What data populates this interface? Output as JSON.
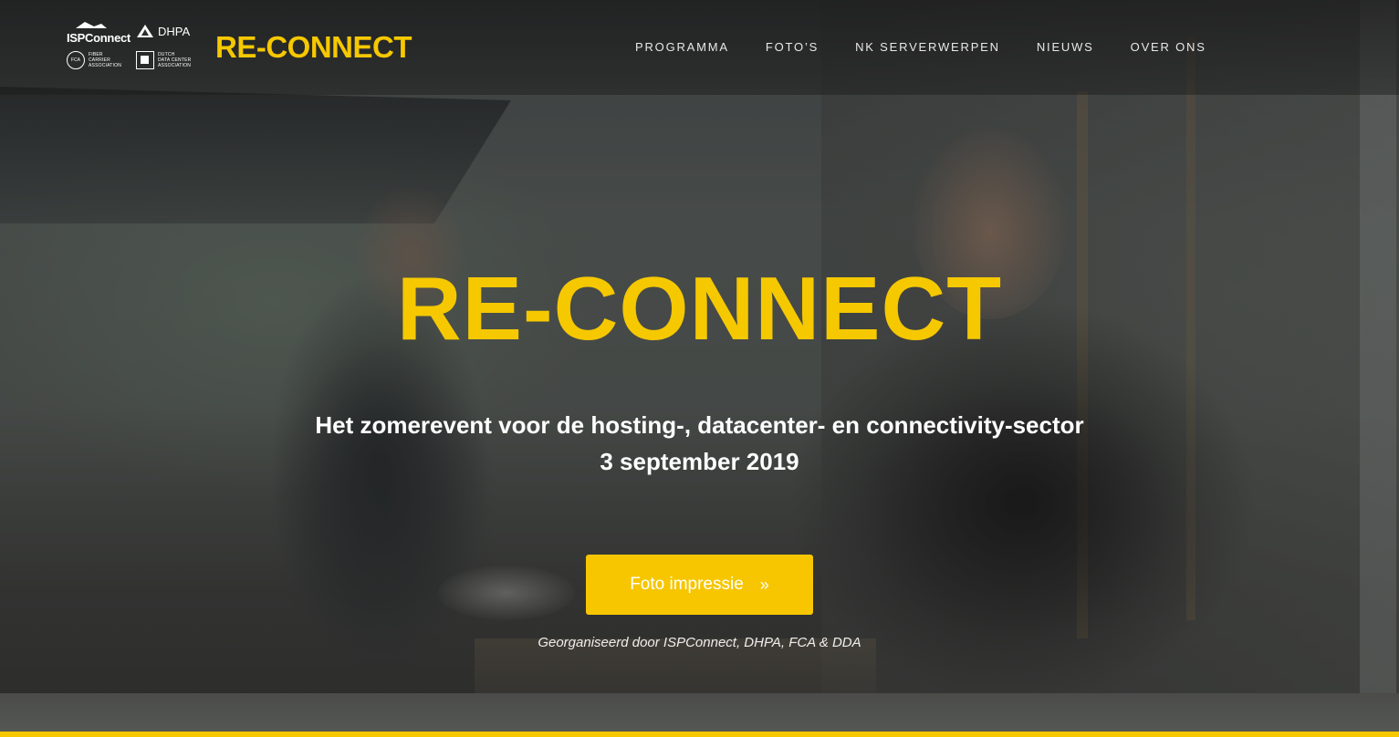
{
  "header": {
    "logos": {
      "ispconnect": "ISPConnect",
      "dhpa": "DHPA",
      "fca": "FCA",
      "fca_text": [
        "FIBER",
        "CARRIER",
        "ASSOCIATION"
      ],
      "dda_text": [
        "DUTCH",
        "DATA CENTER",
        "ASSOCIATION"
      ]
    },
    "brand": "RE-CONNECT",
    "nav": [
      "PROGRAMMA",
      "FOTO’S",
      "NK SERVERWERPEN",
      "NIEUWS",
      "OVER ONS"
    ]
  },
  "hero": {
    "title": "RE-CONNECT",
    "subtitle": "Het zomerevent voor de hosting-, datacenter- en connectivity-sector",
    "date": "3 september 2019",
    "cta_label": "Foto impressie",
    "cta_icon": "double-chevron-right-icon",
    "organized_by": "Georganiseerd door ISPConnect, DHPA, FCA & DDA"
  },
  "colors": {
    "accent": "#f5c800",
    "text": "#ffffff"
  }
}
